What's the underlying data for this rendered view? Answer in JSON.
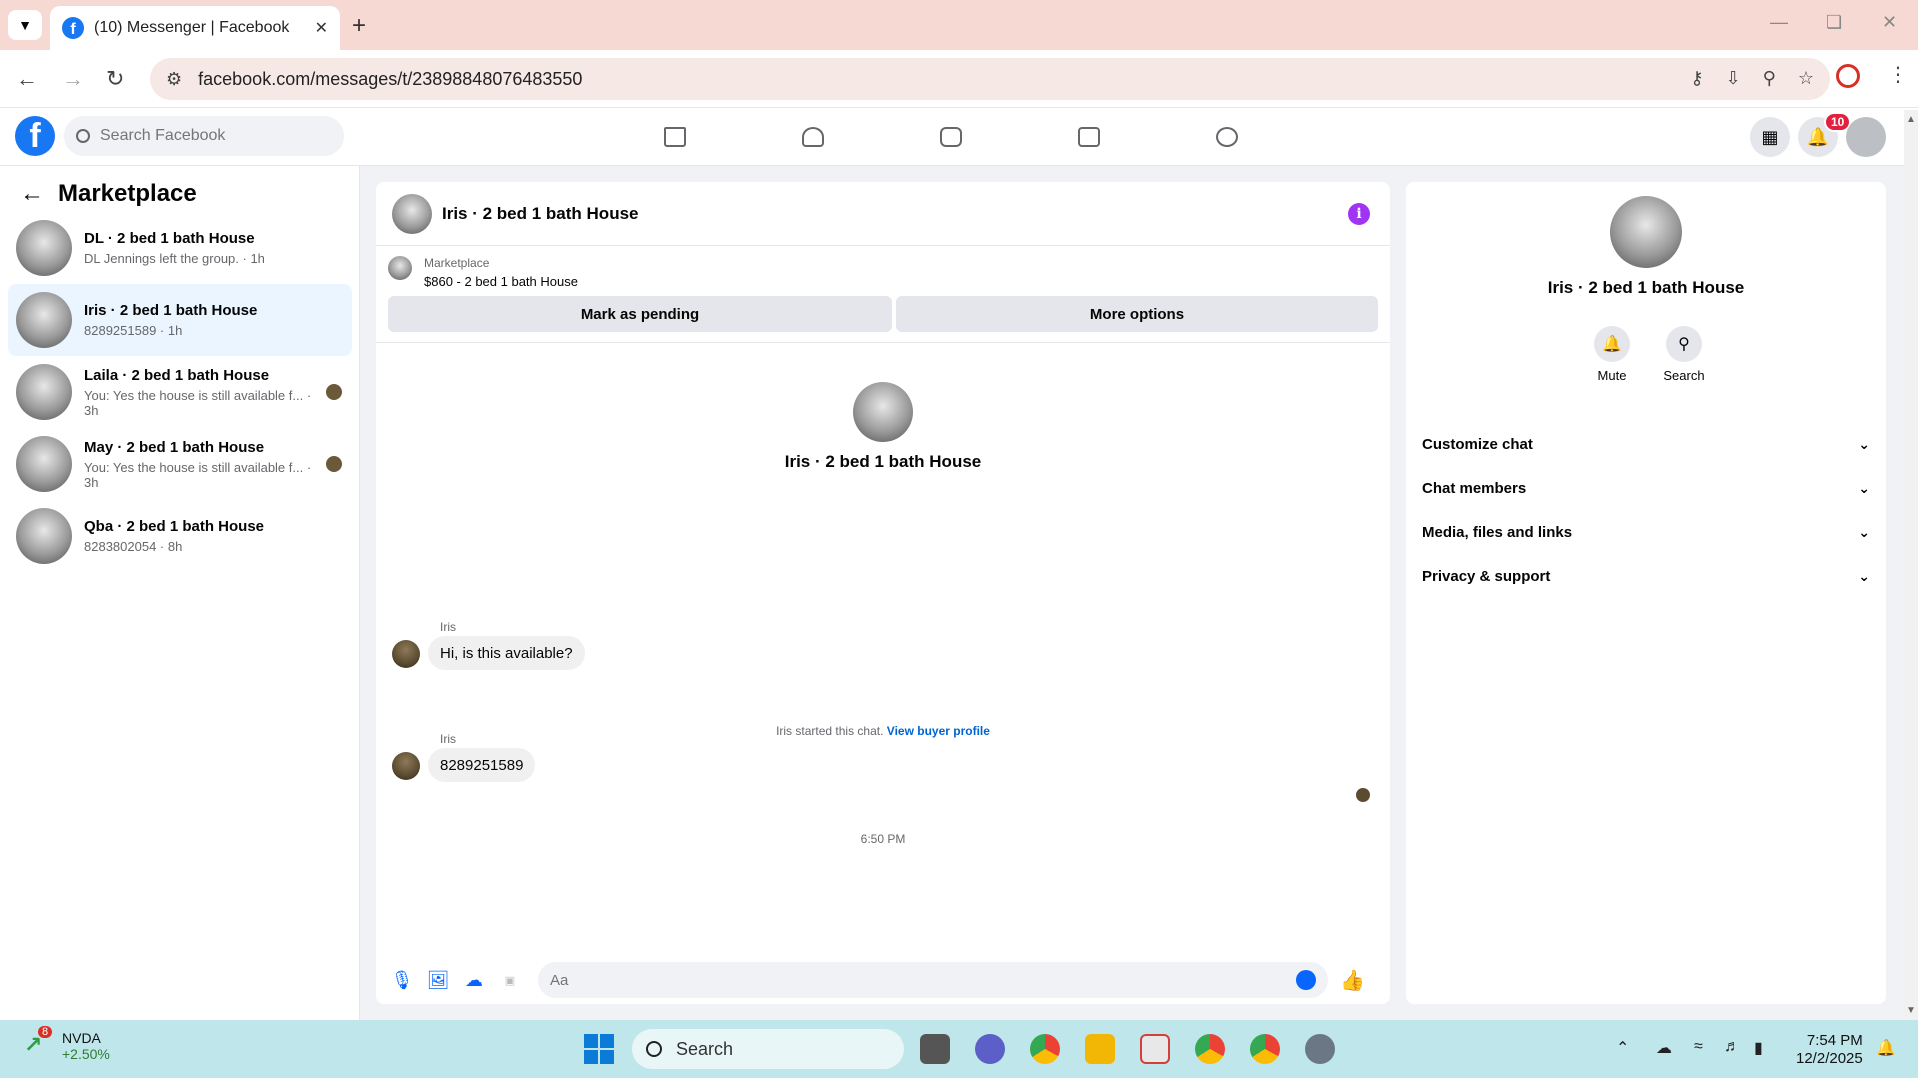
{
  "browser": {
    "tab_title": "(10) Messenger | Facebook",
    "url": "facebook.com/messages/t/23898848076483550"
  },
  "fb": {
    "search_placeholder": "Search Facebook",
    "notif_count": "10"
  },
  "left": {
    "title": "Marketplace",
    "conversations": [
      {
        "name": "DL · 2 bed 1 bath House",
        "sub": "DL Jennings left the group. · 1h"
      },
      {
        "name": "Iris · 2 bed 1 bath House",
        "sub": "8289251589 · 1h"
      },
      {
        "name": "Laila · 2 bed 1 bath House",
        "sub": "You: Yes the house is still available f...  · 3h"
      },
      {
        "name": "May · 2 bed 1 bath House",
        "sub": "You: Yes the house is still available f...  · 3h"
      },
      {
        "name": "Qba · 2 bed 1 bath House",
        "sub": "8283802054 · 8h"
      }
    ]
  },
  "chat": {
    "title": "Iris · 2 bed 1 bath House",
    "marketplace_label": "Marketplace",
    "listing": "$860 - 2 bed 1 bath House",
    "btn_pending": "Mark as pending",
    "btn_more": "More options",
    "center_name": "Iris · 2 bed 1 bath House",
    "started_text": "Iris started this chat.",
    "view_profile": "View buyer profile",
    "messages": [
      {
        "sender": "Iris",
        "text": "Hi, is this available?"
      },
      {
        "sender": "Iris",
        "text": "8289251589"
      }
    ],
    "timestamp": "6:50 PM",
    "input_placeholder": "Aa"
  },
  "right": {
    "name": "Iris · 2 bed 1 bath House",
    "mute": "Mute",
    "search": "Search",
    "sections": [
      "Customize chat",
      "Chat members",
      "Media, files and links",
      "Privacy & support"
    ]
  },
  "taskbar": {
    "stock_name": "NVDA",
    "stock_change": "+2.50%",
    "stock_badge": "8",
    "search": "Search",
    "time": "7:54 PM",
    "date": "12/2/2025"
  }
}
